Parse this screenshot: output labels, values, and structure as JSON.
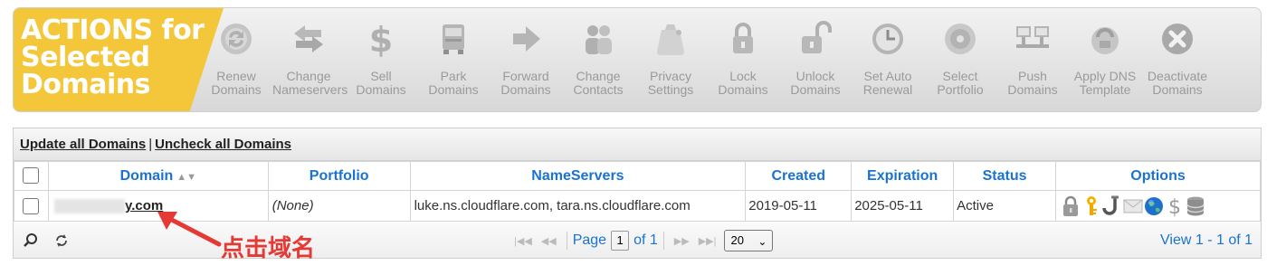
{
  "actions_banner": {
    "lines": [
      "ACTIONS for",
      "Selected",
      "Domains"
    ],
    "color": "#f4c73a"
  },
  "actions": [
    {
      "icon": "refresh-icon",
      "lines": [
        "Renew",
        "Domains"
      ]
    },
    {
      "icon": "swap-arrows-icon",
      "lines": [
        "Change",
        "Nameservers"
      ]
    },
    {
      "icon": "dollar-icon",
      "lines": [
        "Sell",
        "Domains"
      ]
    },
    {
      "icon": "truck-icon",
      "lines": [
        "Park",
        "Domains"
      ]
    },
    {
      "icon": "forward-arrow-icon",
      "lines": [
        "Forward",
        "Domains"
      ]
    },
    {
      "icon": "contacts-icon",
      "lines": [
        "Change",
        "Contacts"
      ]
    },
    {
      "icon": "privacy-bag-icon",
      "lines": [
        "Privacy",
        "Settings"
      ]
    },
    {
      "icon": "lock-icon",
      "lines": [
        "Lock",
        "Domains"
      ]
    },
    {
      "icon": "unlock-icon",
      "lines": [
        "Unlock",
        "Domains"
      ]
    },
    {
      "icon": "clock-icon",
      "lines": [
        "Set Auto",
        "Renewal"
      ]
    },
    {
      "icon": "portfolio-disc-icon",
      "lines": [
        "Select",
        "Portfolio"
      ]
    },
    {
      "icon": "push-monitors-icon",
      "lines": [
        "Push",
        "Domains"
      ]
    },
    {
      "icon": "dns-template-icon",
      "lines": [
        "Apply DNS",
        "Template"
      ]
    },
    {
      "icon": "deactivate-x-icon",
      "lines": [
        "Deactivate",
        "Domains"
      ]
    }
  ],
  "table_top": {
    "update_all": "Update all Domains",
    "separator": "|",
    "uncheck_all": "Uncheck all Domains"
  },
  "columns": {
    "domain": "Domain",
    "portfolio": "Portfolio",
    "nameservers": "NameServers",
    "created": "Created",
    "expiration": "Expiration",
    "status": "Status",
    "options": "Options"
  },
  "row": {
    "domain_visible": "y.com",
    "portfolio": "(None)",
    "nameservers": "luke.ns.cloudflare.com, tara.ns.cloudflare.com",
    "created": "2019-05-11",
    "expiration": "2025-05-11",
    "status": "Active",
    "option_icons": [
      "lock-icon",
      "key-icon",
      "hook-icon",
      "envelope-icon",
      "globe-icon",
      "dollar-icon",
      "database-icon"
    ]
  },
  "pager": {
    "page_label": "Page",
    "page_value": "1",
    "of_label": "of 1",
    "per_page": "20",
    "view_range": "View 1 - 1 of 1"
  },
  "annotation": {
    "label": "点击域名",
    "color": "#e53935"
  },
  "colors": {
    "link_blue": "#1a73d0",
    "icon_gray": "#a8a8a8"
  }
}
